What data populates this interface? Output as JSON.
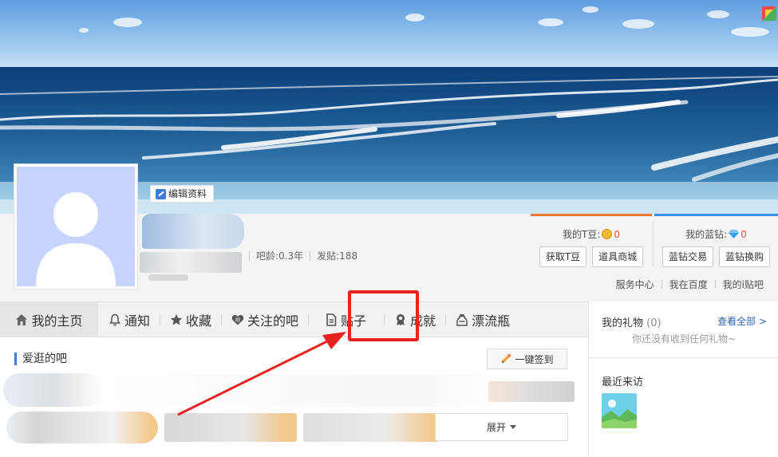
{
  "profile": {
    "edit_label": "编辑资料",
    "age_label": "吧龄:0.3年",
    "posts_label": "发贴:188"
  },
  "wallet": {
    "tdou_label": "我的T豆:",
    "tdou_value": "0",
    "tdou_buttons": [
      "获取T豆",
      "道具商城"
    ],
    "zuan_label": "我的蓝钻:",
    "zuan_value": "0",
    "zuan_buttons": [
      "蓝钻交易",
      "蓝钻换购"
    ]
  },
  "top_links": [
    "服务中心",
    "我在百度",
    "我的i贴吧"
  ],
  "nav": {
    "items": [
      {
        "label": "我的主页",
        "icon": "home-icon"
      },
      {
        "label": "通知",
        "icon": "bell-icon"
      },
      {
        "label": "收藏",
        "icon": "star-icon"
      },
      {
        "label": "关注的吧",
        "icon": "heart-icon"
      },
      {
        "label": "贴子",
        "icon": "document-icon"
      },
      {
        "label": "成就",
        "icon": "medal-icon"
      },
      {
        "label": "漂流瓶",
        "icon": "bottle-icon"
      }
    ]
  },
  "sidebar": {
    "gift_title": "我的礼物",
    "gift_count": "(0)",
    "view_all": "查看全部 >",
    "gift_empty": "你还没有收到任何礼物~",
    "visitor_title": "最近来访"
  },
  "main": {
    "section_title": "爱逛的吧",
    "sign_button": "一键签到",
    "expand_button": "展开"
  },
  "colors": {
    "accent_red": "#e8231f",
    "tdou_orange": "#f07a3a",
    "zuan_blue": "#3c8ff0",
    "link_blue": "#2d64b3"
  }
}
